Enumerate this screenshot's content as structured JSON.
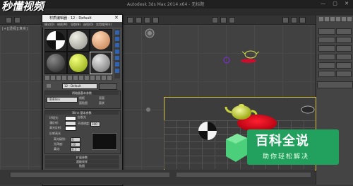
{
  "watermark_logo": "秒懂视频",
  "app_title": "Autodesk 3ds Max 2014 x64 - 无标题",
  "window_controls": "— ▢ ✕",
  "viewport": {
    "label": "[+][透视][真实]"
  },
  "material_editor": {
    "title": "材质编辑器 - 12 - Default",
    "menu": [
      "模式(D)",
      "材质(M)",
      "导航(N)",
      "选项(O)",
      "实用程序(U)"
    ],
    "slots": [
      {
        "name": "checker",
        "color": "#ffffff",
        "selected": false
      },
      {
        "name": "stone",
        "color": "#b9b9b0",
        "selected": false
      },
      {
        "name": "skin",
        "color": "#e6a878",
        "selected": false
      },
      {
        "name": "dark",
        "color": "#3a3a3a",
        "selected": false
      },
      {
        "name": "lime",
        "color": "#c8e21e",
        "selected": false
      },
      {
        "name": "grey",
        "color": "#a9a9a9",
        "selected": true
      }
    ],
    "name_value": "12 - Default",
    "shader_header": "明暗器基本参数",
    "shader_value": "(B)Blinn",
    "shader_checks": [
      "线框",
      "双面",
      "面贴图",
      "面状"
    ],
    "basic_header": "Blinn 基本参数",
    "self_illum_label": "自发光",
    "color_labels": [
      "环境光:",
      "漫反射:",
      "高光反射:"
    ],
    "color_swatches": [
      "#f2f2f2",
      "#dcdcdc",
      "#ffffff"
    ],
    "spec_header": "反射高光",
    "spec_labels": [
      "高光级别:",
      "光泽度:",
      "柔化:"
    ],
    "spec_values": [
      "0",
      "10",
      "0.1"
    ],
    "opacity_label": "不透明度:",
    "opacity_value": "100",
    "rollouts": [
      "扩展参数",
      "超级采样",
      "贴图"
    ]
  },
  "branding": {
    "title": "百科全说",
    "subtitle": "助你轻松解决",
    "color": "#21a15d"
  }
}
